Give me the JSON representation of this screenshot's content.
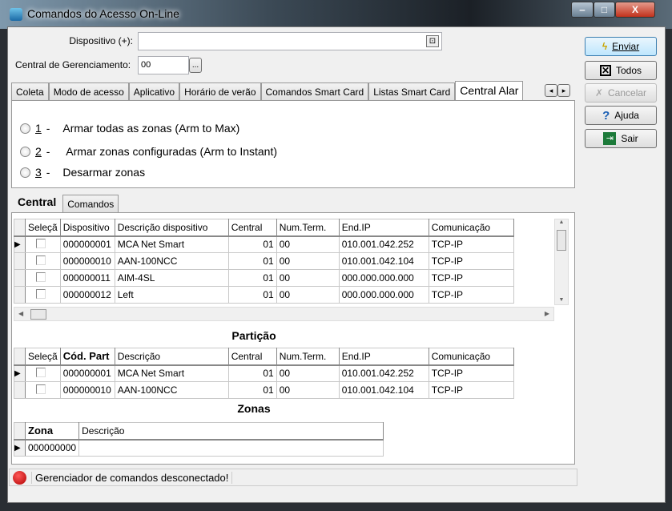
{
  "window": {
    "title": "Comandos do Acesso On-Line",
    "min": "‒",
    "max": "□",
    "close": "X"
  },
  "form": {
    "dispositivo_label": "Dispositivo (+):",
    "dispositivo_value": "",
    "central_label": "Central de Gerenciamento:",
    "central_value": "00",
    "browse_label": "..."
  },
  "tabs": [
    "Coleta",
    "Modo de acesso",
    "Aplicativo",
    "Horário de verão",
    "Comandos Smart Card",
    "Listas Smart Card",
    "Central Alar"
  ],
  "tab_scroll": {
    "left": "◂",
    "right": "▸"
  },
  "radios": [
    {
      "num": "1",
      "sep": "-",
      "label": "Armar todas as zonas (Arm to Max)"
    },
    {
      "num": "2",
      "sep": "-",
      "label": "Armar zonas configuradas (Arm to Instant)"
    },
    {
      "num": "3",
      "sep": "-",
      "label": "Desarmar zonas"
    }
  ],
  "subtabs": [
    "Central",
    "Comandos"
  ],
  "central_grid": {
    "columns": [
      "Seleçã",
      "Dispositivo",
      "Descrição dispositivo",
      "Central",
      "Num.Term.",
      "End.IP",
      "Comunicação"
    ],
    "rows": [
      [
        "000000001",
        "MCA Net Smart",
        "01",
        "00",
        "010.001.042.252",
        "TCP-IP"
      ],
      [
        "000000010",
        "AAN-100NCC",
        "01",
        "00",
        "010.001.042.104",
        "TCP-IP"
      ],
      [
        "000000011",
        "AIM-4SL",
        "01",
        "00",
        "000.000.000.000",
        "TCP-IP"
      ],
      [
        "000000012",
        "Left",
        "01",
        "00",
        "000.000.000.000",
        "TCP-IP"
      ]
    ]
  },
  "particao": {
    "title": "Partição",
    "columns": [
      "Seleçã",
      "Cód. Part",
      "Descrição",
      "Central",
      "Num.Term.",
      "End.IP",
      "Comunicação"
    ],
    "rows": [
      [
        "000000001",
        "MCA Net Smart",
        "01",
        "00",
        "010.001.042.252",
        "TCP-IP"
      ],
      [
        "000000010",
        "AAN-100NCC",
        "01",
        "00",
        "010.001.042.104",
        "TCP-IP"
      ]
    ]
  },
  "zonas": {
    "title": "Zonas",
    "columns": [
      "Zona",
      "Descrição"
    ],
    "rows": [
      [
        "000000000",
        ""
      ]
    ]
  },
  "status": {
    "text": "Gerenciador de comandos desconectado!",
    "color": "#cc0000"
  },
  "buttons": {
    "enviar": "Enviar",
    "todos": "Todos",
    "cancelar": "Cancelar",
    "ajuda": "Ajuda",
    "sair": "Sair"
  }
}
